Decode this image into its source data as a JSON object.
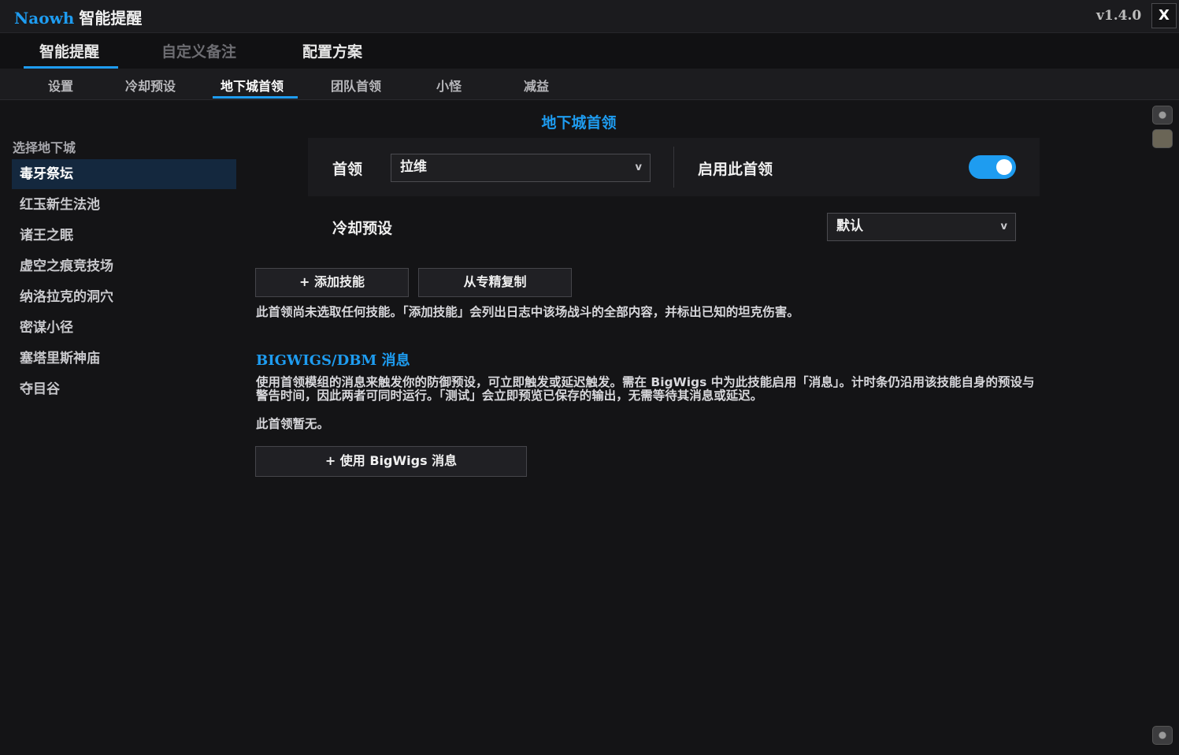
{
  "app": {
    "brand": "Naowh",
    "title": "智能提醒",
    "version": "v1.4.0",
    "close_label": "X"
  },
  "main_tabs": [
    {
      "label": "智能提醒",
      "active": true
    },
    {
      "label": "自定义备注",
      "active": false
    },
    {
      "label": "配置方案",
      "active": false
    }
  ],
  "sub_tabs": [
    {
      "label": "设置"
    },
    {
      "label": "冷却预设"
    },
    {
      "label": "地下城首领",
      "active": true
    },
    {
      "label": "团队首领"
    },
    {
      "label": "小怪"
    },
    {
      "label": "减益"
    }
  ],
  "sidebar": {
    "title": "选择地下城",
    "items": [
      {
        "label": "毒牙祭坛",
        "active": true
      },
      {
        "label": "红玉新生法池"
      },
      {
        "label": "诸王之眠"
      },
      {
        "label": "虚空之痕竞技场"
      },
      {
        "label": "纳洛拉克的洞穴"
      },
      {
        "label": "密谋小径"
      },
      {
        "label": "塞塔里斯神庙"
      },
      {
        "label": "夺目谷"
      }
    ]
  },
  "content": {
    "section_title": "地下城首领",
    "boss_label": "首领",
    "boss_value": "拉维",
    "chevron": "v",
    "enable_label": "启用此首领",
    "enable_on": true,
    "cooldown_label": "冷却预设",
    "cooldown_value": "默认",
    "add_skill_label": "+ 添加技能",
    "copy_spec_label": "从专精复制",
    "no_skill_note": "此首领尚未选取任何技能。「添加技能」会列出日志中该场战斗的全部内容，并标出已知的坦克伤害。",
    "bigwigs_title_a": "BIGWIGS/DBM",
    "bigwigs_title_b": "消息",
    "bigwigs_desc": "使用首领模组的消息来触发你的防御预设，可立即触发或延迟触发。需在 BigWigs 中为此技能启用「消息」。计时条仍沿用该技能自身的预设与警告时间，因此两者可同时运行。「测试」会立即预览已保存的输出，无需等待其消息或延迟。",
    "none_note": "此首领暂无。",
    "use_bigwigs_label": "+ 使用 BigWigs 消息"
  },
  "colors": {
    "accent": "#1e9cf0",
    "background": "#141416",
    "panel": "#1b1b1e",
    "sidebar_active": "#14283e"
  }
}
